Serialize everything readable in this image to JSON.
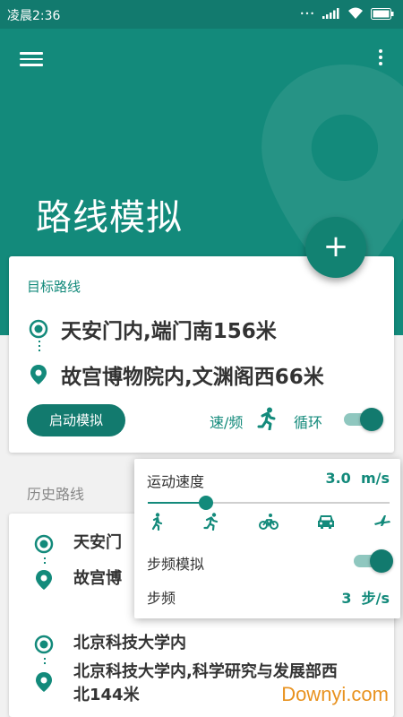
{
  "status_bar": {
    "time": "凌晨2:36"
  },
  "header": {
    "title": "路线模拟"
  },
  "fab": {
    "label": "+"
  },
  "target_card": {
    "label": "目标路线",
    "start": "天安门内,端门南156米",
    "end": "故宫博物院内,文渊阁西66米",
    "start_button": "启动模拟",
    "speed_link": "速/频",
    "loop_label": "循环",
    "loop_enabled": true
  },
  "history": {
    "label": "历史路线",
    "items": [
      {
        "start": "天安门",
        "end": "故宫博"
      },
      {
        "start": "北京科技大学内",
        "end_line1": "北京科技大学内,科学研究与发展部西",
        "end_line2": "北144米"
      }
    ]
  },
  "speed_popup": {
    "speed_label": "运动速度",
    "speed_value": "3.0  m/s",
    "speed_fraction": 0.24,
    "modes": [
      "walk-icon",
      "run-icon",
      "bike-icon",
      "car-icon",
      "plane-icon"
    ],
    "step_sim_label": "步频模拟",
    "step_sim_enabled": true,
    "step_label": "步频",
    "step_value": "3  步/s"
  },
  "watermark": "Downyi.com",
  "colors": {
    "primary": "#138a7b",
    "primary_dark": "#127a6e",
    "toggle_track": "#8fc7bf",
    "watermark": "#e8921f"
  }
}
